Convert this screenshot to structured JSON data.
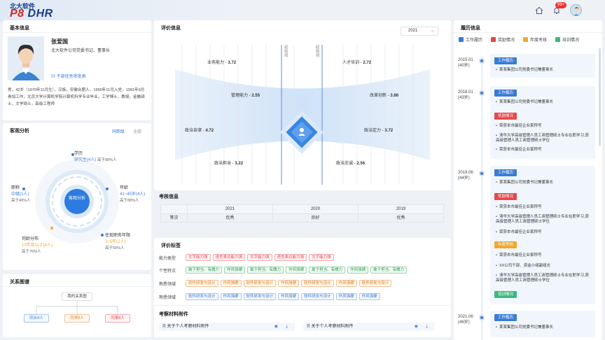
{
  "header": {
    "logo_top": "北大软件",
    "logo_main_a": "P8",
    "logo_main_b": " DHR",
    "notif_count": "99+"
  },
  "basic": {
    "title": "基本信息",
    "name": "张爱国",
    "position": "北大软件公司党委书记、董事长",
    "link": "干部任免审批表",
    "bio": "男，42岁（1970年11月生），汉族，安徽合肥人，1990年11月入党，1991年9月参加工作，北京大学计算机学院计算机科学专业毕业，工学博士，教授，金融硕士，文学硕士，高级工程师"
  },
  "objective": {
    "title": "客观分析",
    "tab1": "同职级",
    "tab2": "全部",
    "center": "客观分析",
    "items": [
      {
        "title": "学历",
        "value": "研究生(4人)",
        "note": "高于88%人"
      },
      {
        "title": "职称",
        "value": "中级(1人)",
        "note": "高于40%人"
      },
      {
        "title": "年龄",
        "value": "41~45岁(4人)",
        "note": "高于88%人"
      },
      {
        "title": "司龄分布",
        "value": "10年及以上(4人)",
        "note": "高于76%人"
      },
      {
        "title": "任现职务年限",
        "value": "3~5年(2人)",
        "note": "高于50%人"
      }
    ]
  },
  "relation": {
    "title": "关系图谱",
    "root": "我的关系图",
    "nodes": [
      "同乡8人",
      "同学8人",
      "同事8人"
    ]
  },
  "evaluation": {
    "title": "评价信息",
    "year": "2021",
    "axis1": "起始线",
    "axis2": "起始线",
    "labels": [
      {
        "name": "业务能力",
        "score": "3.72"
      },
      {
        "name": "管理能力",
        "score": "2.55"
      },
      {
        "name": "政治自律",
        "score": "4.72"
      },
      {
        "name": "政治担当",
        "score": "3.22"
      },
      {
        "name": "人才培训",
        "score": "2.72"
      },
      {
        "name": "改革创新",
        "score": "3.86"
      },
      {
        "name": "政治定力",
        "score": "3.72"
      },
      {
        "name": "政治忠诚",
        "score": "2.56"
      }
    ]
  },
  "assess": {
    "title": "考核信息",
    "headers": [
      "",
      "2021",
      "2020",
      "2019"
    ],
    "row": [
      "等次",
      "优秀",
      "良好",
      "优秀"
    ]
  },
  "tags": {
    "title": "评价标签",
    "rows": [
      {
        "label": "能力类型",
        "tags": [
          "文字能力强",
          "语言表达能力强",
          "文字能力强",
          "语言表达能力强",
          "文字能力强"
        ]
      },
      {
        "label": "个性特点",
        "tags": [
          "敢于担当、有魄力",
          "作风强硬",
          "敢于担当、有魄力",
          "作风强硬",
          "敢于担当、有魄力",
          "作风强硬",
          "敢于担当、有魄力"
        ]
      },
      {
        "label": "熟悉领域",
        "tags": [
          "软件研发与设计",
          "作风强硬",
          "软件研发与设计",
          "作风强硬",
          "软件研发与设计",
          "作风强硬",
          "软件研发与设计"
        ]
      },
      {
        "label": "熟悉领域",
        "tags": [
          "软件研发与设计",
          "作风强硬",
          "软件研发与设计",
          "作风强硬",
          "软件研发与设计",
          "作风强硬",
          "作风强硬"
        ]
      }
    ]
  },
  "materials": {
    "title": "考察材料附件",
    "file1": "关于个人考察材料附件",
    "file2": "关于个人考察材料附件"
  },
  "history": {
    "title": "履历信息",
    "legend": [
      "工作履历",
      "奖励情况",
      "年度考核",
      "培训情况"
    ],
    "colors": {
      "work": "#3a7bd5",
      "award": "#e5484d",
      "annual": "#f0a82e",
      "train": "#3cb97c"
    },
    "entries": [
      {
        "date": "2015.01",
        "age": "(40岁)",
        "groups": [
          {
            "tag": "工作履历",
            "items": [
              "某某集团公司党委书记兼董事长"
            ]
          }
        ]
      },
      {
        "date": "2018.01",
        "age": "(43岁)",
        "groups": [
          {
            "tag": "工作履历",
            "items": [
              "某某集团公司党委书记兼董事长"
            ]
          },
          {
            "tag": "奖励情况",
            "items": [
              "荣获本市最佳企业家称号",
              "清华大学高级管理人员工商管理硕士专业在职学习,获高级管理人员工商管理硕士学位",
              "荣获本市最佳企业家称号"
            ]
          }
        ]
      },
      {
        "date": "2019.06",
        "age": "(44岁)",
        "groups": [
          {
            "tag": "工作履历",
            "items": [
              "某某集团公司党委书记兼董事长"
            ]
          },
          {
            "tag": "奖励情况",
            "items": [
              "荣获本市最佳企业家称号",
              "清华大学高级管理人员工商管理硕士专业在职学习,获高级管理人员工商管理硕士学位",
              "荣获本市最佳企业家称号"
            ]
          },
          {
            "tag": "年度考核",
            "items": [
              "荣获本市最佳企业家称号",
              "XX公司干部、资金小组副组长",
              "清华大学高级管理人员工商管理硕士专业在职学习,获高级管理人员工商管理硕士学位"
            ]
          },
          {
            "tag": "培训情况",
            "items": []
          }
        ]
      },
      {
        "date": "2021.06",
        "age": "(46岁)",
        "groups": [
          {
            "tag": "工作履历",
            "items": [
              "某某集团公司党委书记兼董事长"
            ]
          }
        ]
      }
    ]
  }
}
